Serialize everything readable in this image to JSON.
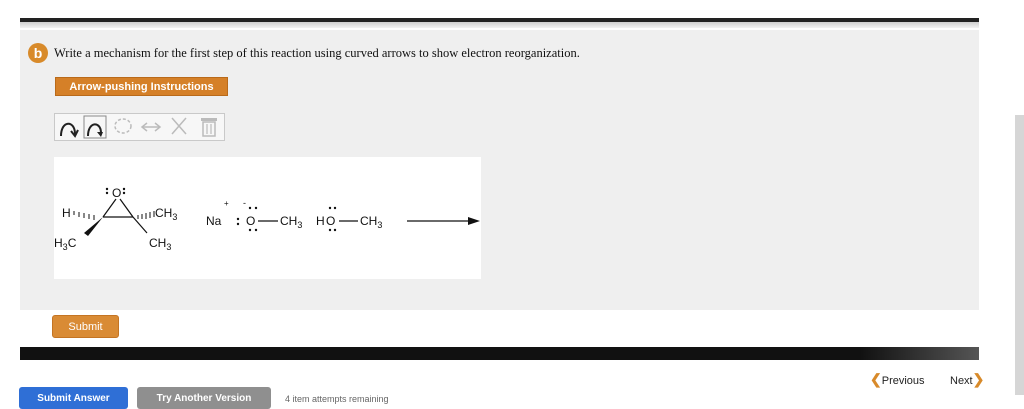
{
  "question": {
    "badge": "b",
    "text": "Write a mechanism for the first step of this reaction using curved arrows to show electron reorganization."
  },
  "instructions_button": "Arrow-pushing Instructions",
  "toolbar": {
    "tools": [
      "curved-arrow-icon",
      "single-electron-arrow-icon",
      "lasso-icon",
      "double-arrow-icon",
      "delete-x-icon",
      "trash-icon"
    ]
  },
  "reaction": {
    "epoxide": {
      "oxygen": "O",
      "left_top": "H",
      "left_bottom": "H",
      "left_bottom_sub": "3",
      "left_bottom_c": "C",
      "right_top": "CH",
      "right_top_sub": "3",
      "right_bottom": "CH",
      "right_bottom_sub": "3"
    },
    "sodium_methoxide": {
      "cation": "Na",
      "plus": "+",
      "minus": "-",
      "oxygen": "O",
      "methyl": "CH",
      "methyl_sub": "3"
    },
    "methanol": {
      "h": "H",
      "oxygen": "O",
      "methyl": "CH",
      "methyl_sub": "3"
    }
  },
  "submit_label": "Submit",
  "navigation": {
    "previous": "Previous",
    "next": "Next"
  },
  "footer": {
    "submit_answer": "Submit Answer",
    "try_another": "Try Another Version",
    "attempts": "4 item attempts remaining"
  }
}
